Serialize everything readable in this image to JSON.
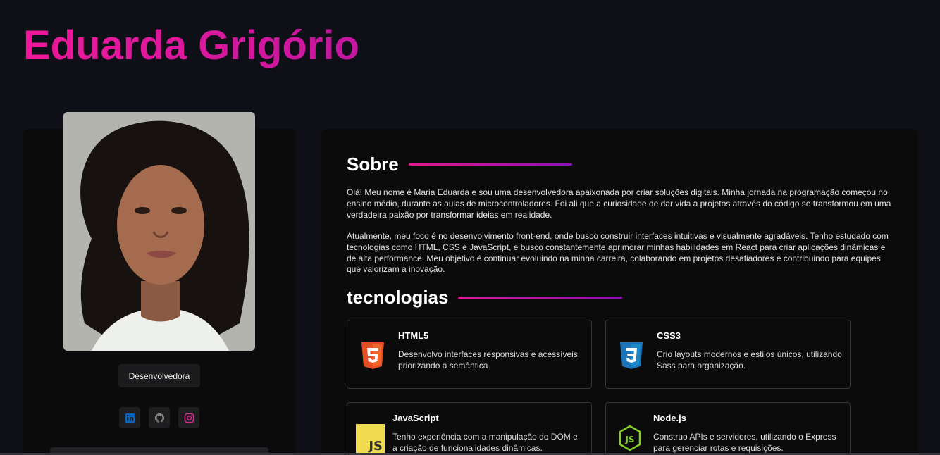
{
  "header": {
    "name": "Eduarda Grigório"
  },
  "profile": {
    "role": "Desenvolvedora",
    "social": [
      {
        "name": "linkedin-icon",
        "color": "#0a66c2"
      },
      {
        "name": "github-icon",
        "color": "#9a9a9a"
      },
      {
        "name": "instagram-icon",
        "color": "#d62f8c"
      }
    ]
  },
  "about": {
    "title": "Sobre",
    "paragraphs": [
      "Olá! Meu nome é Maria Eduarda e sou uma desenvolvedora apaixonada por criar soluções digitais. Minha jornada na programação começou no ensino médio, durante as aulas de microcontroladores. Foi ali que a curiosidade de dar vida a projetos através do código se transformou em uma verdadeira paixão por transformar ideias em realidade.",
      "Atualmente, meu foco é no desenvolvimento front-end, onde busco construir interfaces intuitivas e visualmente agradáveis. Tenho estudado com tecnologias como HTML, CSS e JavaScript, e busco constantemente aprimorar minhas habilidades em React para criar aplicações dinâmicas e de alta performance. Meu objetivo é continuar evoluindo na minha carreira, colaborando em projetos desafiadores e contribuindo para equipes que valorizam a inovação."
    ]
  },
  "technologies": {
    "title": "tecnologias",
    "items": [
      {
        "name": "HTML5",
        "description": "Desenvolvo interfaces responsivas e acessíveis, priorizando a semântica.",
        "icon": "html5-icon",
        "color": "#e44d26"
      },
      {
        "name": "CSS3",
        "description": "Crio layouts modernos e estilos únicos, utilizando Sass para organização.",
        "icon": "css3-icon",
        "color": "#1b73ba"
      },
      {
        "name": "JavaScript",
        "description": "Tenho experiência com a manipulação do DOM e a criação de funcionalidades dinâmicas.",
        "icon": "javascript-icon",
        "color": "#f0db4f"
      },
      {
        "name": "Node.js",
        "description": "Construo APIs e servidores, utilizando o Express para gerenciar rotas e requisições.",
        "icon": "nodejs-icon",
        "color": "#83cd29"
      }
    ]
  },
  "colors": {
    "accent": "#e51899",
    "background": "#0e0f17",
    "card": "#0b0b0c"
  }
}
